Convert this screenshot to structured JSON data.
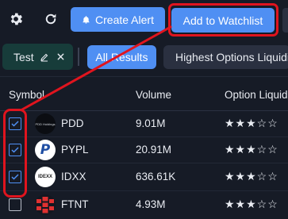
{
  "toolbar": {
    "create_alert_label": "Create Alert",
    "add_watchlist_label": "Add to Watchlist"
  },
  "filters": {
    "saved_chip_label": "Test",
    "all_results_label": "All Results",
    "preset_label": "Highest Options Liquidity"
  },
  "table": {
    "headers": {
      "symbol": "Symbol",
      "volume": "Volume",
      "liquidity": "Option Liquidity"
    },
    "rows": [
      {
        "symbol": "PDD",
        "volume": "9.01M",
        "liquidity_stars": 3,
        "checked": true,
        "logo_text": "PDD Holdings"
      },
      {
        "symbol": "PYPL",
        "volume": "20.91M",
        "liquidity_stars": 3,
        "checked": true,
        "logo_text": "P"
      },
      {
        "symbol": "IDXX",
        "volume": "636.61K",
        "liquidity_stars": 3,
        "checked": true,
        "logo_text": "IDEXX"
      },
      {
        "symbol": "FTNT",
        "volume": "4.93M",
        "liquidity_stars": 3,
        "checked": false,
        "logo_text": ""
      }
    ]
  },
  "colors": {
    "background": "#161b26",
    "accent": "#4f8ff3",
    "annotation": "#e0141e",
    "chip": "#173c3a"
  }
}
